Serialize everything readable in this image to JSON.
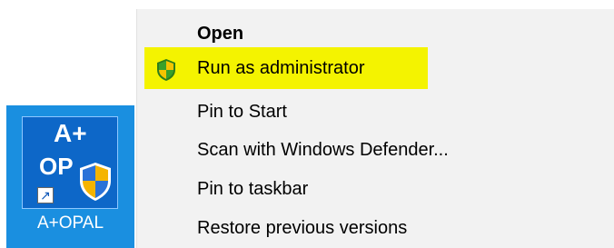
{
  "desktop_icon": {
    "tile_line1": "A+",
    "tile_line2": "OP",
    "label": "A+OPAL"
  },
  "context_menu": {
    "items": [
      {
        "label": "Open",
        "bold": true
      },
      {
        "label": "Run as administrator",
        "icon": "uac-shield-icon",
        "highlighted": true
      },
      {
        "label": "Pin to Start"
      },
      {
        "label": "Scan with Windows Defender..."
      },
      {
        "label": "Pin to taskbar"
      },
      {
        "label": "Restore previous versions"
      }
    ]
  },
  "colors": {
    "highlight": "#f4f300",
    "desktop_blue": "#1a8fe0",
    "menu_bg": "#f2f2f2"
  }
}
